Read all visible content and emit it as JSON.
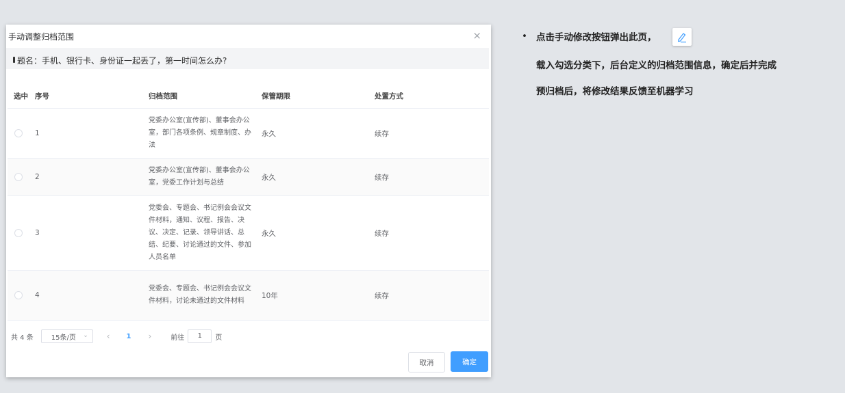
{
  "dialog": {
    "title": "手动调整归档范围",
    "close": "×",
    "topic": "题名：手机、银行卡、身份证一起丢了，第一时间怎么办?",
    "columns": [
      "选中",
      "序号",
      "归档范围",
      "保管期限",
      "处置方式"
    ],
    "rows": [
      {
        "no": "1",
        "scope": "党委办公室(宣传部)、董事会办公室，部门各项条例、规章制度、办法",
        "term": "永久",
        "disposal": "续存"
      },
      {
        "no": "2",
        "scope": "党委办公室(宣传部)、董事会办公室，党委工作计划与总结",
        "term": "永久",
        "disposal": "续存"
      },
      {
        "no": "3",
        "scope": "党委会、专题会、书记例会会议文件材料，通知、议程、报告、决议、决定、记录、领导讲话、总结、纪要、讨论通过的文件、参加人员名单",
        "term": "永久",
        "disposal": "续存"
      },
      {
        "no": "4",
        "scope": "党委会、专题会、书记例会会议文件材料，讨论未通过的文件材料",
        "term": "10年",
        "disposal": "续存"
      }
    ],
    "pager": {
      "total": "共 4 条",
      "page_size": "15条/页",
      "prev": "‹",
      "current": "1",
      "next": "›",
      "goto_prefix": "前往",
      "goto_value": "1",
      "goto_suffix": "页"
    },
    "buttons": {
      "cancel": "取消",
      "ok": "确定"
    }
  },
  "notes": {
    "bullet": "•",
    "line1": "点击手动修改按钮弹出此页，",
    "line2": "载入勾选分类下，后台定义的归档范围信息，确定后并完成",
    "line3": "预归档后，将修改结果反馈至机器学习"
  },
  "icons": {
    "edit": "pencil-edit-icon"
  },
  "colors": {
    "primary": "#409eff",
    "background": "#e2e5e9"
  }
}
